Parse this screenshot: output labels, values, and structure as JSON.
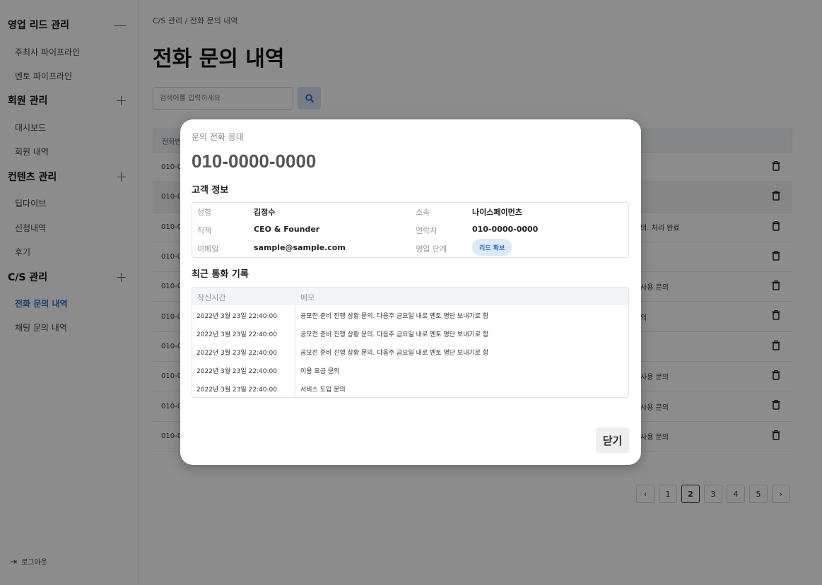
{
  "sidebar": {
    "groups": [
      {
        "title": "영업 리드 관리",
        "toggle": "—",
        "items": [
          "주최사 파이프라인",
          "멘토 파이프라인"
        ]
      },
      {
        "title": "회원 관리",
        "toggle": "+",
        "items": [
          "대시보드",
          "회원 내역"
        ]
      },
      {
        "title": "컨텐츠 관리",
        "toggle": "+",
        "items": [
          "딥다이브",
          "신청내역",
          "후기"
        ]
      },
      {
        "title": "C/S 관리",
        "toggle": "+",
        "items": [
          "전화 문의 내역",
          "채팅 문의 내역"
        ]
      }
    ],
    "logout": "로그아웃"
  },
  "main": {
    "breadcrumb": "C/S 관리 / 전화 문의 내역",
    "title": "전화 문의 내역",
    "search_placeholder": "검색어를 입력하세요",
    "table": {
      "header": "전화번",
      "rows": [
        {
          "phone": "010-0",
          "memo": ""
        },
        {
          "phone": "010-0",
          "memo": ""
        },
        {
          "phone": "010-0",
          "memo": "의. 처리 완료"
        },
        {
          "phone": "010-0",
          "memo": ""
        },
        {
          "phone": "010-0",
          "memo": "사용 문의"
        },
        {
          "phone": "010-0",
          "memo": "의"
        },
        {
          "phone": "010-0",
          "memo": ""
        },
        {
          "phone": "010-0",
          "memo": "사용 문의"
        },
        {
          "phone": "010-0",
          "memo": "사용 문의"
        },
        {
          "phone": "010-0",
          "memo": "사용 문의"
        }
      ]
    },
    "pagination": {
      "prev": "‹",
      "pages": [
        "1",
        "2",
        "3",
        "4",
        "5"
      ],
      "current": "2",
      "next": "›"
    }
  },
  "modal": {
    "subtitle": "문의 전화 응대",
    "phone": "010-0000-0000",
    "customer_section": "고객 정보",
    "customer": {
      "name_label": "성함",
      "name": "김정수",
      "org_label": "소속",
      "org": "나이스페이먼츠",
      "position_label": "직책",
      "position": "CEO & Founder",
      "contact_label": "연락처",
      "contact": "010-0000-0000",
      "email_label": "이메일",
      "email": "sample@sample.com",
      "stage_label": "영업 단계",
      "stage": "리드 확보"
    },
    "calls_section": "최근 통화 기록",
    "calls_header": {
      "time": "착신시간",
      "memo": "메모"
    },
    "calls": [
      {
        "time": "2022년 3월 23일 22:40:00",
        "memo": "공모전 준비 진행 상황 문의. 다음주 금요일 내로 멘토 명단 보내기로 함"
      },
      {
        "time": "2022년 3월 23일 22:40:00",
        "memo": "공모전 준비 진행 상황 문의. 다음주 금요일 내로 멘토 명단 보내기로 함"
      },
      {
        "time": "2022년 3월 23일 22:40:00",
        "memo": "공모전 준비 진행 상황 문의. 다음주 금요일 내로 멘토 명단 보내기로 함"
      },
      {
        "time": "2022년 3월 23일 22:40:00",
        "memo": "이용 요금 문의"
      },
      {
        "time": "2022년 3월 23일 22:40:00",
        "memo": "서비스 도입 문의"
      }
    ],
    "close_label": "닫기"
  },
  "colors": {
    "accent": "#2f6fd6",
    "badge_bg": "#dde9f8",
    "overlay": "rgba(0,0,0,0.45)"
  }
}
